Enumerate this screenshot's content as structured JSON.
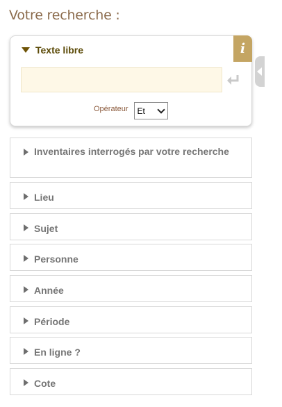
{
  "page_title": "Votre recherche :",
  "free_text": {
    "title": "Texte libre",
    "info_label": "i",
    "input_value": "",
    "input_placeholder": "",
    "operator_label": "Opérateur",
    "operator_value": "Et"
  },
  "facets": [
    {
      "label": "Inventaires interrogés par votre recherche"
    },
    {
      "label": "Lieu"
    },
    {
      "label": "Sujet"
    },
    {
      "label": "Personne"
    },
    {
      "label": "Année"
    },
    {
      "label": "Période"
    },
    {
      "label": "En ligne ?"
    },
    {
      "label": "Cote"
    }
  ],
  "colors": {
    "title": "#8b6b4c",
    "accent": "#c4a563",
    "input_bg": "#fef8e7",
    "facet_text": "#757575"
  },
  "icons": {
    "info": "info-icon",
    "enter": "enter-return-icon",
    "collapse_tab": "chevron-left-icon"
  }
}
